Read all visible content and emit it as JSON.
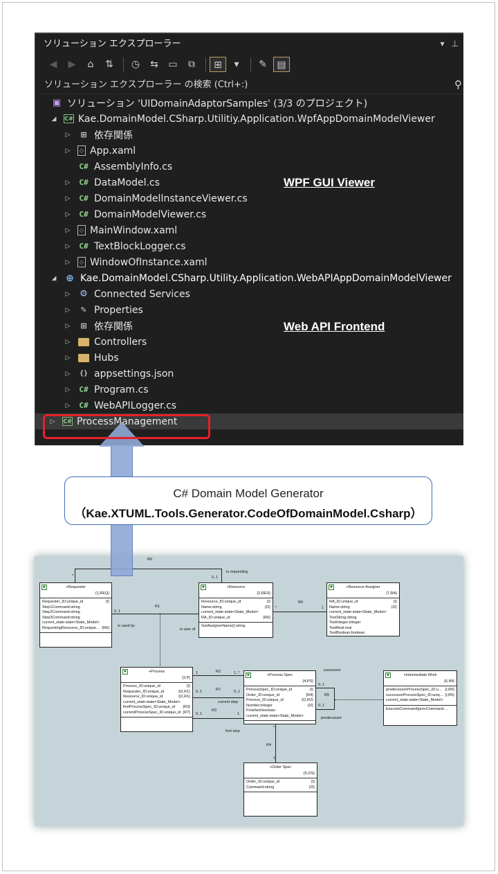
{
  "explorer": {
    "title": "ソリューション エクスプローラー",
    "title_controls": [
      "▾",
      "⊥"
    ],
    "search_placeholder": "ソリューション エクスプローラー の検索 (Ctrl+:)",
    "solution_label": "ソリューション 'UIDomainAdaptorSamples' (3/3 のプロジェクト)",
    "rows": [
      {
        "label": "Kae.DomainModel.CSharp.Utilitiy.Application.WpfAppDomainModelViewer",
        "icon": "project-icon"
      },
      {
        "label": "依存関係",
        "icon": "dependencies-icon"
      },
      {
        "label": "App.xaml",
        "icon": "xaml-file-icon"
      },
      {
        "label": "AssemblyInfo.cs",
        "icon": "csharp-file-icon"
      },
      {
        "label": "DataModel.cs",
        "icon": "csharp-file-icon"
      },
      {
        "label": "DomainModelInstanceViewer.cs",
        "icon": "csharp-file-icon"
      },
      {
        "label": "DomainModelViewer.cs",
        "icon": "csharp-file-icon"
      },
      {
        "label": "MainWindow.xaml",
        "icon": "xaml-file-icon"
      },
      {
        "label": "TextBlockLogger.cs",
        "icon": "csharp-file-icon"
      },
      {
        "label": "WindowOfInstance.xaml",
        "icon": "xaml-file-icon"
      },
      {
        "label": "Kae.DomainModel.CSharp.Utility.Application.WebAPIAppDomainModelViewer",
        "icon": "web-project-icon"
      },
      {
        "label": "Connected Services",
        "icon": "connected-services-icon"
      },
      {
        "label": "Properties",
        "icon": "properties-icon"
      },
      {
        "label": "依存関係",
        "icon": "dependencies-icon"
      },
      {
        "label": "Controllers",
        "icon": "folder-icon"
      },
      {
        "label": "Hubs",
        "icon": "folder-icon"
      },
      {
        "label": "appsettings.json",
        "icon": "json-file-icon"
      },
      {
        "label": "Program.cs",
        "icon": "csharp-file-icon"
      },
      {
        "label": "WebAPILogger.cs",
        "icon": "csharp-file-icon"
      },
      {
        "label": "ProcessManagement",
        "icon": "project-icon"
      }
    ]
  },
  "annotations": {
    "wpf": "WPF GUI Viewer ",
    "web": "Web API Frontend "
  },
  "generator": {
    "line1": "C# Domain Model Generator",
    "line2": "（Kae.XTUML.Tools.Generator.CodeOfDomainModel.Csharp）"
  },
  "diagram": {
    "classes": {
      "requester": {
        "name": "+Requester",
        "key": "{1,REQ}",
        "attrs": [
          [
            "Requester_ID:unique_id",
            "{I}"
          ],
          [
            "Step1Command:string",
            ""
          ],
          [
            "Step2Command:string",
            ""
          ],
          [
            "Step3Command:string",
            ""
          ],
          [
            "current_state:state<State_Model>",
            ""
          ],
          [
            "RequestingResource_ID:unique...",
            "{R6}"
          ]
        ],
        "ops": []
      },
      "resource": {
        "name": "+Resource",
        "key": "{2,RES}",
        "attrs": [
          [
            "Resource_ID:unique_id",
            "{I}"
          ],
          [
            "Name:string",
            "{I2}"
          ],
          [
            "current_state:state<State_Model>",
            ""
          ],
          [
            "RA_ID:unique_id",
            "{R6}"
          ]
        ],
        "ops": [
          "GetAssignerName():string"
        ]
      },
      "assigner": {
        "name": "+Resource Assigner",
        "key": "{7,RA}",
        "attrs": [
          [
            "RA_ID:unique_id",
            "{I}"
          ],
          [
            "Name:string",
            "{I2}"
          ],
          [
            "current_state:state<State_Model>",
            ""
          ],
          [
            "TestString:string",
            ""
          ],
          [
            "TestInteger:integer",
            ""
          ],
          [
            "TestReal:real",
            ""
          ],
          [
            "TestBoolean:boolean",
            ""
          ]
        ],
        "ops": []
      },
      "process": {
        "name": "+Process",
        "key": "{3,P}",
        "attrs": [
          [
            "Process_ID:unique_id",
            "{I}"
          ],
          [
            "Requester_ID:unique_id",
            "{I2,R1}"
          ],
          [
            "Resource_ID:unique_id",
            "{I2,R1}"
          ],
          [
            "current_state:state<State_Model>",
            ""
          ],
          [
            "firstProcessSpec_ID:unique_id",
            "{R3}"
          ],
          [
            "currentProcessSpec_ID:unique_id",
            "{R7}"
          ]
        ],
        "ops": []
      },
      "spec": {
        "name": "+Process Spec",
        "key": "{4,PS}",
        "attrs": [
          [
            "ProcessSpec_ID:unique_id",
            "{I}"
          ],
          [
            "Order_ID:unique_id",
            "{R4}"
          ],
          [
            "Process_ID:unique_id",
            "{I2,R2}"
          ],
          [
            "Number:integer",
            "{I2}"
          ],
          [
            "Finished:boolean",
            ""
          ],
          [
            "current_state:state<State_Model>",
            ""
          ]
        ],
        "ops": []
      },
      "work": {
        "name": "+Intermediate Work",
        "key": "{6,IW}",
        "attrs": [
          [
            "predecessorProcessSpec_ID:u...",
            "{I,R5}"
          ],
          [
            "successorProcessSpec_ID:uniq...",
            "{I,R5}"
          ],
          [
            "current_state:state<State_Model>",
            ""
          ]
        ],
        "ops": [
          "ExecuteCommand(prevCommand:..."
        ]
      },
      "order": {
        "name": "+Order Spec",
        "key": "{5,OS}",
        "attrs": [
          [
            "Order_ID:unique_id",
            "{I}"
          ],
          [
            "Command:string",
            "{I2}"
          ]
        ],
        "ops": []
      }
    },
    "labels": {
      "r6a": "R6",
      "is_requesting": "is requesting",
      "star1": "*",
      "zero1a": "0..1",
      "r1": "R1",
      "zero1b": "0..1",
      "is_used_by": "is used by",
      "is_user_of": "is user of",
      "r6b": "R6",
      "star2": "*",
      "one1": "1",
      "r2": "R2",
      "one2": "1",
      "onestar": "1..*",
      "r7": "R7",
      "zero1c": "0..1",
      "zero1d": "0..1",
      "current_step": "current step",
      "r3": "R3",
      "zero1e": "0..1",
      "one3": "1",
      "first_step": "first step",
      "successor": "successor",
      "predecessor": "predecessor",
      "r5": "R5",
      "zero1f": "0..1",
      "zero1g": "0..1",
      "r4": "R4",
      "star3": "*",
      "one4": "1"
    }
  }
}
